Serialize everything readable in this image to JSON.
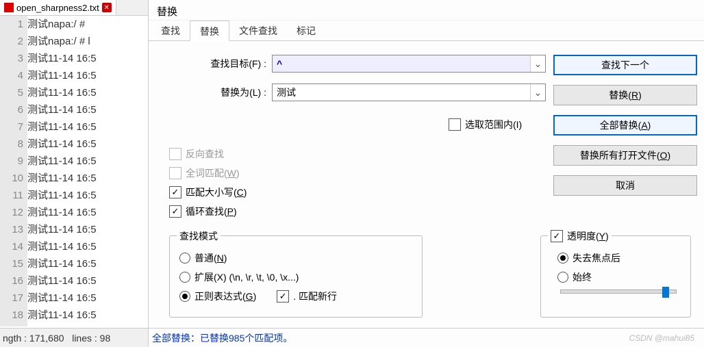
{
  "editor": {
    "tab_name": "open_sharpness2.txt",
    "lines": [
      "测试napa:/ #",
      "测试napa:/ # l",
      "测试11-14 16:5",
      "测试11-14 16:5",
      "测试11-14 16:5",
      "测试11-14 16:5",
      "测试11-14 16:5",
      "测试11-14 16:5",
      "测试11-14 16:5",
      "测试11-14 16:5",
      "测试11-14 16:5",
      "测试11-14 16:5",
      "测试11-14 16:5",
      "测试11-14 16:5",
      "测试11-14 16:5",
      "测试11-14 16:5",
      "测试11-14 16:5",
      "测试11-14 16:5"
    ],
    "status_length_label": "ngth :",
    "status_length_value": "171,680",
    "status_lines_label": "lines :",
    "status_lines_value": "98"
  },
  "dialog": {
    "title": "替换",
    "tabs": {
      "find": "查找",
      "replace": "替换",
      "find_in_files": "文件查找",
      "mark": "标记"
    },
    "labels": {
      "find_what": "查找目标(F) : ",
      "replace_with": "替换为(L) : ",
      "in_selection": "选取范围内(I)",
      "backward": "反向查找",
      "whole_word": "全词匹配(W)",
      "match_case": "匹配大小写(C)",
      "wrap": "循环查找(P)",
      "search_mode": "查找模式",
      "normal": "普通(N)",
      "extended": "扩展(X) (\\n, \\r, \\t, \\0, \\x...)",
      "regex": "正则表达式(G)",
      "dot_newline": ". 匹配新行",
      "transparency": "透明度(Y)",
      "on_lose_focus": "失去焦点后",
      "always": "始终"
    },
    "values": {
      "find_what": "^",
      "replace_with": "测试"
    },
    "buttons": {
      "find_next": "查找下一个",
      "replace": "替换(R)",
      "replace_all": "全部替换(A)",
      "replace_all_open": "替换所有打开文件(O)",
      "cancel": "取消"
    },
    "status": {
      "prefix": "全部替换：",
      "message": "已替换985个匹配项。"
    }
  },
  "watermark": "CSDN @mahui85"
}
